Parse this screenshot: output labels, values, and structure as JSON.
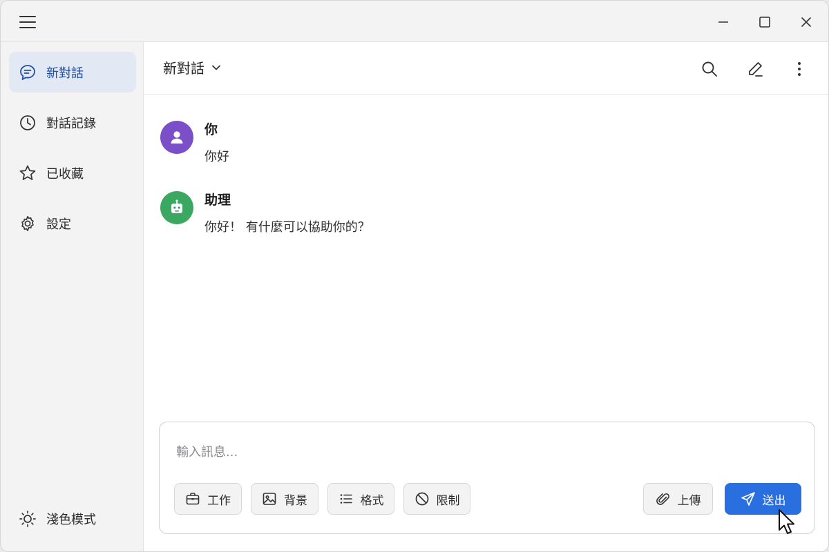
{
  "titlebar": {
    "menu_icon": "hamburger-icon",
    "controls": [
      "minimize-icon",
      "maximize-icon",
      "close-icon"
    ]
  },
  "sidebar": {
    "items": [
      {
        "label": "新對話",
        "icon": "chat-bubble-icon",
        "active": true
      },
      {
        "label": "對話記錄",
        "icon": "clock-icon",
        "active": false
      },
      {
        "label": "已收藏",
        "icon": "star-icon",
        "active": false
      },
      {
        "label": "設定",
        "icon": "gear-icon",
        "active": false
      }
    ],
    "theme_toggle": {
      "label": "淺色模式",
      "icon": "sun-icon"
    }
  },
  "header": {
    "title": "新對話",
    "title_icon": "chevron-down-icon",
    "actions": [
      "search-icon",
      "pencil-icon",
      "more-vertical-icon"
    ]
  },
  "messages": [
    {
      "sender": "你",
      "text": "你好",
      "role": "user",
      "avatar_icon": "user-icon",
      "avatar_color": "#7b4fc8"
    },
    {
      "sender": "助理",
      "text": "你好！ 有什麼可以協助你的？",
      "role": "assistant",
      "avatar_icon": "robot-icon",
      "avatar_color": "#3aa860"
    }
  ],
  "composer": {
    "placeholder": "輸入訊息...",
    "value": "",
    "chips": [
      {
        "label": "工作",
        "icon": "briefcase-icon"
      },
      {
        "label": "背景",
        "icon": "image-icon"
      },
      {
        "label": "格式",
        "icon": "list-icon"
      },
      {
        "label": "限制",
        "icon": "block-icon"
      }
    ],
    "upload": {
      "label": "上傳",
      "icon": "paperclip-icon"
    },
    "send": {
      "label": "送出",
      "icon": "send-icon"
    }
  },
  "colors": {
    "accent": "#2a6fe0",
    "active_nav_bg": "#e3e9f4",
    "active_nav_text": "#1d4fa8",
    "sidebar_bg": "#f3f3f4"
  }
}
